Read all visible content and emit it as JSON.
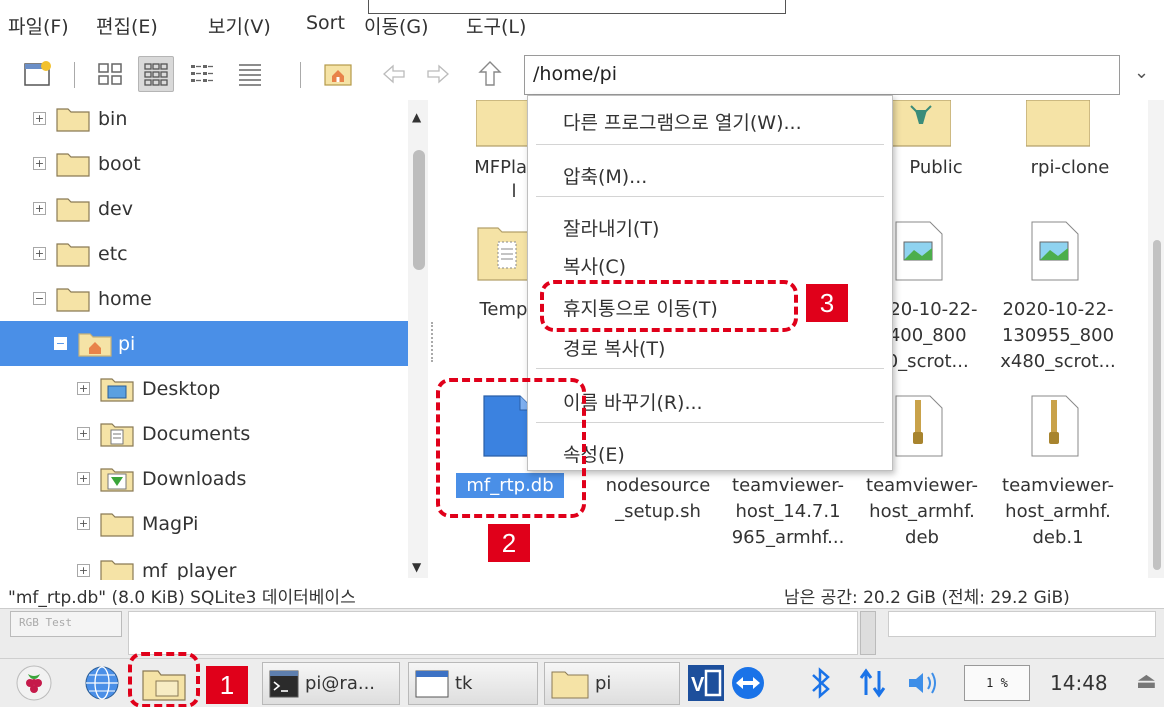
{
  "menubar": {
    "items": [
      "파일(F)",
      "편집(E)",
      "보기(V)",
      "Sort",
      "이동(G)",
      "도구(L)"
    ]
  },
  "toolbar": {
    "path": "/home/pi"
  },
  "tree": {
    "items": [
      {
        "label": "bin",
        "expander": "+"
      },
      {
        "label": "boot",
        "expander": "+"
      },
      {
        "label": "dev",
        "expander": "+"
      },
      {
        "label": "etc",
        "expander": "+"
      },
      {
        "label": "home",
        "expander": "−"
      },
      {
        "label": "pi",
        "expander": "−"
      },
      {
        "label": "Desktop",
        "expander": "+"
      },
      {
        "label": "Documents",
        "expander": "+"
      },
      {
        "label": "Downloads",
        "expander": "+"
      },
      {
        "label": "MagPi",
        "expander": "+"
      },
      {
        "label": "mf_player",
        "expander": "+"
      }
    ]
  },
  "iconview": {
    "row1": [
      "MFPlay",
      "l",
      "Public",
      "rpi-clone"
    ],
    "row2": [
      "Templ",
      "2020-10-22-",
      "0400_800",
      "30_scrot...",
      "2020-10-22-",
      "130955_800",
      "x480_scrot..."
    ],
    "row3": {
      "selected": "mf_rtp.db",
      "nodesource": [
        "nodesource",
        "_setup.sh"
      ],
      "tv1": [
        "teamviewer-",
        "host_14.7.1",
        "965_armhf..."
      ],
      "tv2": [
        "teamviewer-",
        "host_armhf.",
        "deb"
      ],
      "tv3": [
        "teamviewer-",
        "host_armhf.",
        "deb.1"
      ]
    }
  },
  "context_menu": {
    "open_with": "다른 프로그램으로 열기(W)...",
    "compress": "압축(M)...",
    "cut": "잘라내기(T)",
    "copy": "복사(C)",
    "trash": "휴지통으로 이동(T)",
    "copy_path": "경로 복사(T)",
    "rename": "이름 바꾸기(R)...",
    "properties": "속성(E)"
  },
  "status": {
    "left": "\"mf_rtp.db\" (8.0 KiB) SQLite3 데이터베이스",
    "right": "남은 공간: 20.2 GiB (전체: 29.2 GiB)"
  },
  "bgwindow": {
    "label": "RGB Test"
  },
  "taskbar": {
    "terminal": "pi@ra...",
    "tk": "tk",
    "pi": "pi",
    "cpu": "1 %",
    "clock": "14:48"
  },
  "annotations": {
    "one": "1",
    "two": "2",
    "three": "3"
  },
  "colors": {
    "selection": "#4a8fe7",
    "annotation": "#e0001a"
  }
}
